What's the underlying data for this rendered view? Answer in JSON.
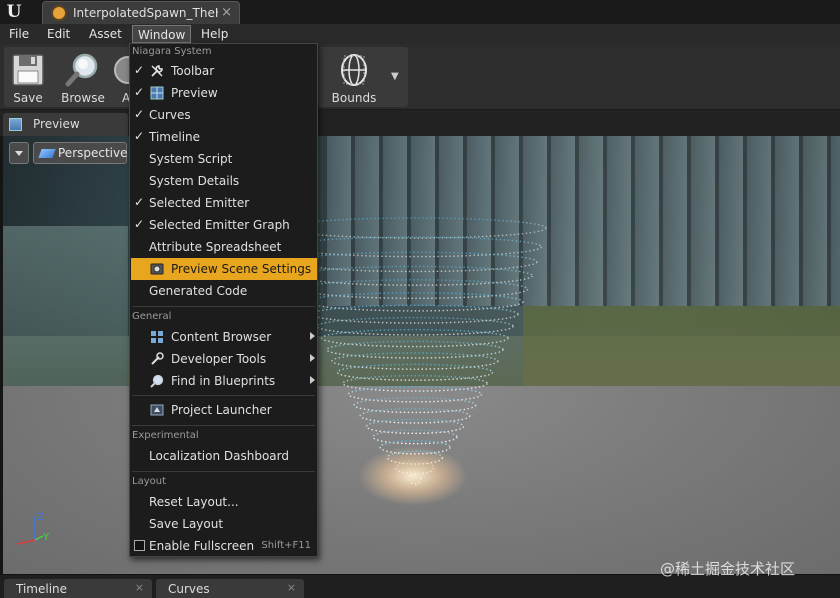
{
  "titlebar": {
    "doc_tab_title": "InterpolatedSpawn_TheHy",
    "close_glyph": "×"
  },
  "menubar": {
    "items": [
      "File",
      "Edit",
      "Asset",
      "Window",
      "Help"
    ]
  },
  "toolbar": {
    "save_label": "Save",
    "browse_label": "Browse",
    "hidden_label": "A",
    "bounds_label": "Bounds"
  },
  "preview_tab": {
    "label": "Preview"
  },
  "viewport": {
    "perspective_label": "Perspective",
    "gizmo_z": "Z",
    "gizmo_y": "Y"
  },
  "window_menu": {
    "niagara_header": "Niagara System",
    "niagara_items": [
      {
        "label": "Toolbar",
        "checked": true,
        "icon": "wrench-icon"
      },
      {
        "label": "Preview",
        "checked": true,
        "icon": "viewport-icon"
      },
      {
        "label": "Curves",
        "checked": true
      },
      {
        "label": "Timeline",
        "checked": true
      },
      {
        "label": "System Script",
        "checked": false
      },
      {
        "label": "System Details",
        "checked": false
      },
      {
        "label": "Selected Emitter",
        "checked": true
      },
      {
        "label": "Selected Emitter Graph",
        "checked": true
      },
      {
        "label": "Attribute Spreadsheet",
        "checked": false
      },
      {
        "label": "Preview Scene Settings",
        "checked": false,
        "icon": "scene-settings-icon",
        "highlighted": true
      },
      {
        "label": "Generated Code",
        "checked": false
      }
    ],
    "general_header": "General",
    "general_items": [
      {
        "label": "Content Browser",
        "icon": "content-browser-icon",
        "submenu": true
      },
      {
        "label": "Developer Tools",
        "icon": "developer-tools-icon",
        "submenu": true
      },
      {
        "label": "Find in Blueprints",
        "icon": "find-icon",
        "submenu": true
      },
      {
        "label": "Project Launcher",
        "icon": "launcher-icon",
        "submenu": false
      }
    ],
    "experimental_header": "Experimental",
    "experimental_items": [
      {
        "label": "Localization Dashboard"
      }
    ],
    "layout_header": "Layout",
    "layout_items": [
      {
        "label": "Reset Layout..."
      },
      {
        "label": "Save Layout"
      },
      {
        "label": "Enable Fullscreen",
        "shortcut": "Shift+F11",
        "checkbox": true
      }
    ]
  },
  "bottom_tabs": [
    {
      "label": "Timeline"
    },
    {
      "label": "Curves"
    }
  ],
  "watermark": "@稀土掘金技术社区",
  "colors": {
    "highlight": "#e8a51e",
    "menu_bg": "#1c1c1c",
    "editor_bg": "#2d2d2d"
  }
}
